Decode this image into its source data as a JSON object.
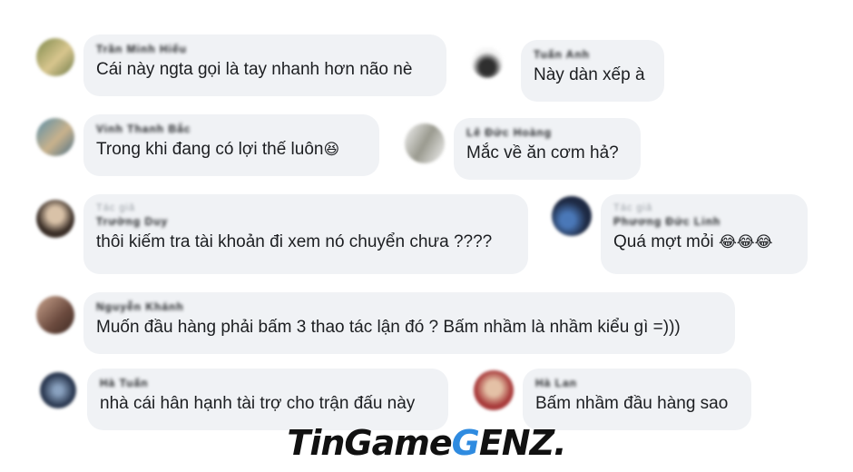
{
  "comments": [
    {
      "name": "Trần Minh Hiếu",
      "text": "Cái này ngta gọi là tay nhanh hơn não nè",
      "colors": [
        "#7f8a4d",
        "#d8c68e"
      ]
    },
    {
      "name": "Tuấn Anh",
      "text": "Này dàn xếp à",
      "colors": [
        "#2f2f2f",
        "#f5f5f5"
      ]
    },
    {
      "name": "Vinh Thanh Bắc",
      "text": "Trong khi đang có lợi thế luôn",
      "emoji": "😆",
      "colors": [
        "#5b8fa8",
        "#c9b28c"
      ]
    },
    {
      "name": "Lê Đức Hoàng",
      "text": "Mắc về ăn cơm hả?",
      "colors": [
        "#9a9a8f",
        "#f4f4f4"
      ]
    },
    {
      "reply": "Tác giả",
      "name": "Trường Duy",
      "text": "thôi kiếm tra tài khoản đi xem nó chuyển chưa ????",
      "colors": [
        "#3a2e27",
        "#d9c2a8"
      ]
    },
    {
      "reply": "Tác giả",
      "name": "Phương Đức Linh",
      "text": "Quá mợt mỏi",
      "emoji": "😂😂😂",
      "colors": [
        "#1e2a44",
        "#4a78b8"
      ]
    },
    {
      "name": "Nguyễn Khánh",
      "text": "Muốn đầu hàng phải bấm 3 thao tác lận đó ? Bấm nhầm là nhầm kiểu gì =)))",
      "colors": [
        "#6b4a3e",
        "#caa48e"
      ]
    },
    {
      "name": "Hà Tuấn",
      "text": "nhà cái hân hạnh tài trợ cho trận đấu này",
      "colors": [
        "#2c3a52",
        "#8aa2c0"
      ]
    },
    {
      "name": "Hà Lan",
      "text": "Bấm nhầm đầu hàng sao",
      "colors": [
        "#a83a3a",
        "#e4c1a6"
      ]
    }
  ],
  "watermark": {
    "prefix": "TinGame",
    "accent": "G",
    "suffix": "ENZ.",
    "accent_color": "#2f8be0"
  }
}
